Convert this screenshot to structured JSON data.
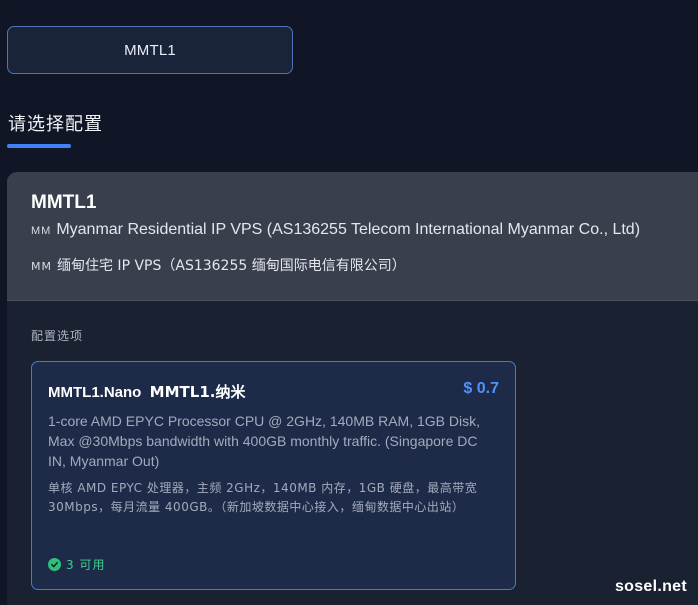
{
  "group_tab": {
    "label": "MMTL1"
  },
  "section": {
    "title": "请选择配置"
  },
  "product": {
    "name": "MMTL1",
    "flag_text": "MM",
    "description_en": "Myanmar Residential IP VPS (AS136255 Telecom International Myanmar Co., Ltd)",
    "description_zh": "缅甸住宅 IP VPS（AS136255 缅甸国际电信有限公司）"
  },
  "options": {
    "label": "配置选项",
    "plans": [
      {
        "name_en": "MMTL1.Nano",
        "name_zh": "MMTL1.纳米",
        "price": "$ 0.7",
        "description_en": "1-core AMD EPYC Processor CPU @ 2GHz, 140MB RAM, 1GB Disk, Max @30Mbps bandwidth with 400GB monthly traffic. (Singapore DC IN, Myanmar Out)",
        "description_zh": "单核 AMD EPYC 处理器，主频 2GHz，140MB 内存，1GB 硬盘，最高带宽 30Mbps，每月流量 400GB。（新加坡数据中心接入，缅甸数据中心出站）",
        "stock": "3 可用"
      }
    ]
  },
  "watermark": "sosel.net",
  "colors": {
    "accent": "#3f82f7",
    "price": "#4e93ff",
    "available": "#3fcf8e"
  }
}
